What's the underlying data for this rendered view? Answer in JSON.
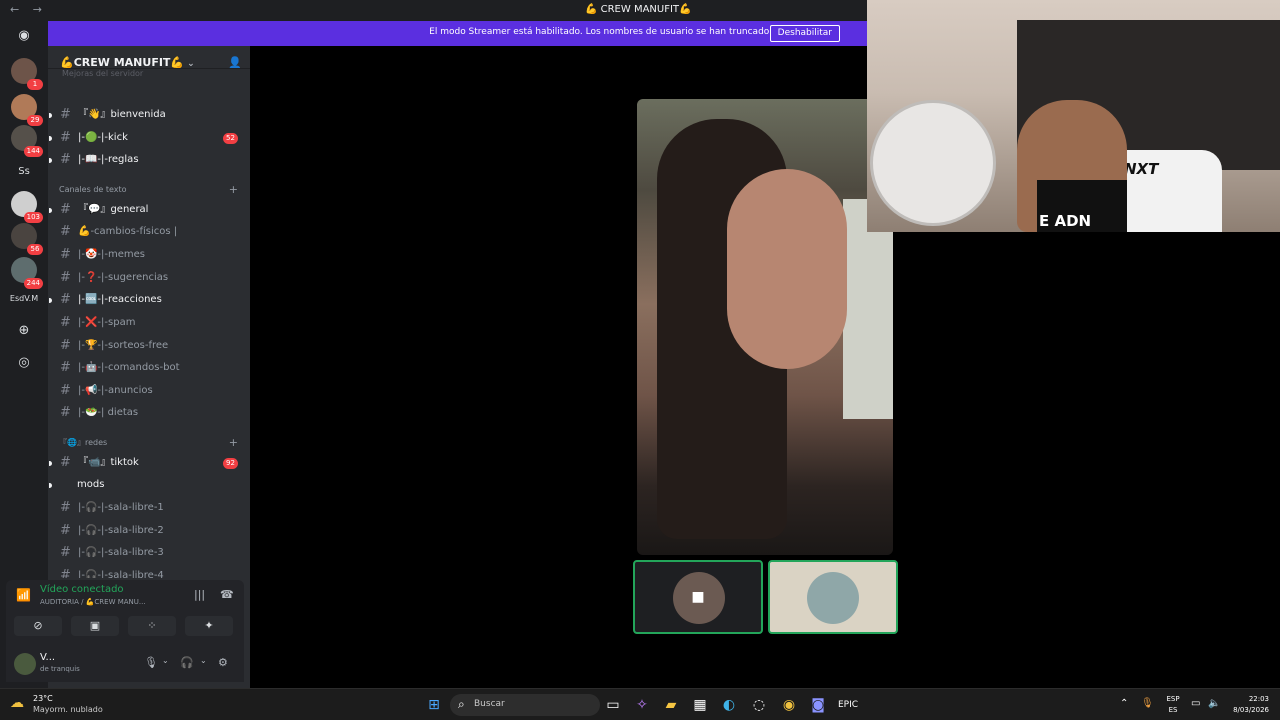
{
  "window": {
    "title": "💪 CREW MANUFIT💪",
    "back_glyph": "←",
    "fwd_glyph": "→"
  },
  "streamer_banner": {
    "message": "El modo Streamer está habilitado. Los nombres de usuario se han truncado.",
    "button": "Deshabilitar"
  },
  "server_rail": {
    "badges": [
      "1",
      "29",
      "144",
      "103",
      "56",
      "244"
    ],
    "text_server_ss": "Ss",
    "text_server_esdvm": "EsdV.M"
  },
  "server": {
    "name": "💪CREW MANUFIT💪",
    "scrolled_top_label": "Mejoras del servidor"
  },
  "channels": [
    {
      "label": "『👋』bienvenida",
      "bold": true,
      "count": ""
    },
    {
      "label": "|-🟢-|-kick",
      "bold": true,
      "count": "52"
    },
    {
      "label": "|-📖-|-reglas",
      "bold": true,
      "count": ""
    }
  ],
  "categories": {
    "text": "Canales de texto",
    "redes": "『🌐』redes"
  },
  "text_channels": [
    {
      "label": "『💬』general",
      "bold": true
    },
    {
      "label": "💪-cambios-físicos |",
      "bold": false
    },
    {
      "label": "|-🤡-|-memes",
      "bold": false
    },
    {
      "label": "|-❓-|-sugerencias",
      "bold": false
    },
    {
      "label": "|-🆒-|-reacciones",
      "bold": true
    },
    {
      "label": "|-❌-|-spam",
      "bold": false
    },
    {
      "label": "|-🏆-|-sorteos-free",
      "bold": false
    },
    {
      "label": "|-🤖-|-comandos-bot",
      "bold": false
    },
    {
      "label": "|-📢-|-anuncios",
      "bold": false
    },
    {
      "label": "|-🥗-| dietas",
      "bold": false
    }
  ],
  "redes_channels": [
    {
      "label": "『📹』tiktok",
      "bold": true,
      "count": "92"
    },
    {
      "label": "mods",
      "bold": true,
      "count": ""
    },
    {
      "label": "|-🎧-|-sala-libre-1",
      "bold": false,
      "count": ""
    },
    {
      "label": "|-🎧-|-sala-libre-2",
      "bold": false,
      "count": ""
    },
    {
      "label": "|-🎧-|-sala-libre-3",
      "bold": false,
      "count": ""
    },
    {
      "label": "|-🎧-|-sala-libre-4",
      "bold": false,
      "count": ""
    }
  ],
  "voice_panel": {
    "status": "Vídeo conectado",
    "subtitle": "AUDITORIA / 💪CREW MANU..."
  },
  "user_panel": {
    "name": "V...",
    "status": "de tranquis"
  },
  "webcam_overlay": {
    "chair_logo": "NXT",
    "shirt_text": "E ADN"
  },
  "taskbar": {
    "temperature": "23°C",
    "weather": "Mayorm. nublado",
    "search_placeholder": "Buscar",
    "lang_top": "ESP",
    "lang_bottom": "ES",
    "time": "22:03",
    "date": "8/03/2026"
  },
  "colors": {
    "banner": "#5b2fe0",
    "connected": "#23a55a",
    "badge": "#f23f43",
    "sidebar": "#2b2d31",
    "rail": "#1e1f22"
  }
}
